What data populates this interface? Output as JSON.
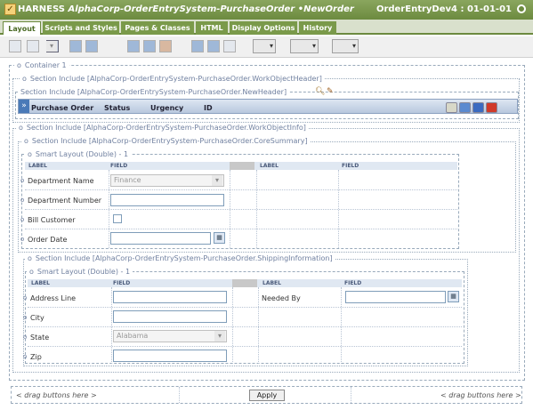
{
  "title": {
    "brand": "HARNESS",
    "rule_name": "AlphaCorp-OrderEntrySystem-PurchaseOrder",
    "bullet": "•",
    "new_label": "NewOrder",
    "ruleset": "OrderEntryDev4 : 01-01-01"
  },
  "tabs": [
    {
      "label": "Layout"
    },
    {
      "label": "Scripts and Styles"
    },
    {
      "label": "Pages & Classes"
    },
    {
      "label": "HTML"
    },
    {
      "label": "Display Options"
    },
    {
      "label": "History"
    }
  ],
  "layout": {
    "container": "Container 1",
    "header_section": "Section Include [AlphaCorp-OrderEntrySystem-PurchaseOrder.WorkObjectHeader]",
    "newheader_section": "Section Include [AlphaCorp-OrderEntrySystem-PurchaseOrder.NewHeader]",
    "header_fields": [
      "Purchase Order",
      "Status",
      "Urgency",
      "ID"
    ],
    "header_prefix": "»",
    "info_section": "Section Include [AlphaCorp-OrderEntrySystem-PurchaseOrder.WorkObjectInfo]",
    "core_section": "Section Include [AlphaCorp-OrderEntrySystem-PurchaseOrder.CoreSummary]",
    "smart_layout": "Smart Layout (Double) - 1",
    "col_label": "LABEL",
    "col_field": "FIELD",
    "bullet": "o",
    "core_rows": [
      {
        "label": "Department Name",
        "value": "Finance"
      },
      {
        "label": "Department Number"
      },
      {
        "label": "Bill Customer"
      },
      {
        "label": "Order Date"
      }
    ],
    "shipping_section": "Section Include [AlphaCorp-OrderEntrySystem-PurchaseOrder.ShippingInformation]",
    "shipping_smart_layout": "Smart Layout (Double) - 1",
    "shipping_rows": [
      {
        "label": "Address Line"
      },
      {
        "label": "City"
      },
      {
        "label": "State",
        "value": "Alabama"
      },
      {
        "label": "Zip"
      }
    ],
    "needed_by": "Needed By",
    "calendar_glyph": "▦"
  },
  "footer": {
    "drag_left": "< drag buttons here >",
    "apply": "Apply",
    "drag_right": "< drag buttons here >"
  }
}
